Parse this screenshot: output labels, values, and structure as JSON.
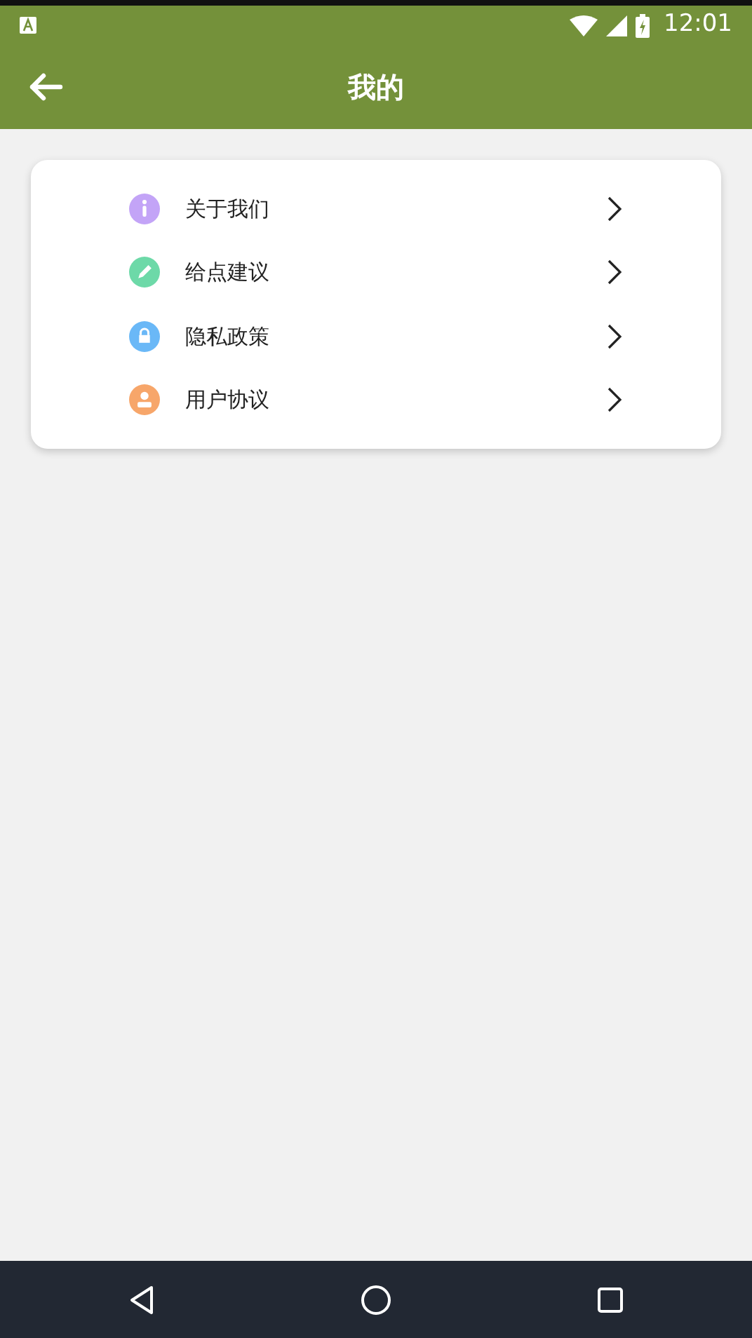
{
  "status_bar": {
    "time": "12:01"
  },
  "app_bar": {
    "title": "我的"
  },
  "menu": [
    {
      "label": "关于我们",
      "kind": "info",
      "color": "#c3a4f7"
    },
    {
      "label": "给点建议",
      "kind": "pencil",
      "color": "#6dd9a8"
    },
    {
      "label": "隐私政策",
      "kind": "lock",
      "color": "#6ab8f7"
    },
    {
      "label": "用户协议",
      "kind": "user",
      "color": "#f7a66a"
    }
  ]
}
